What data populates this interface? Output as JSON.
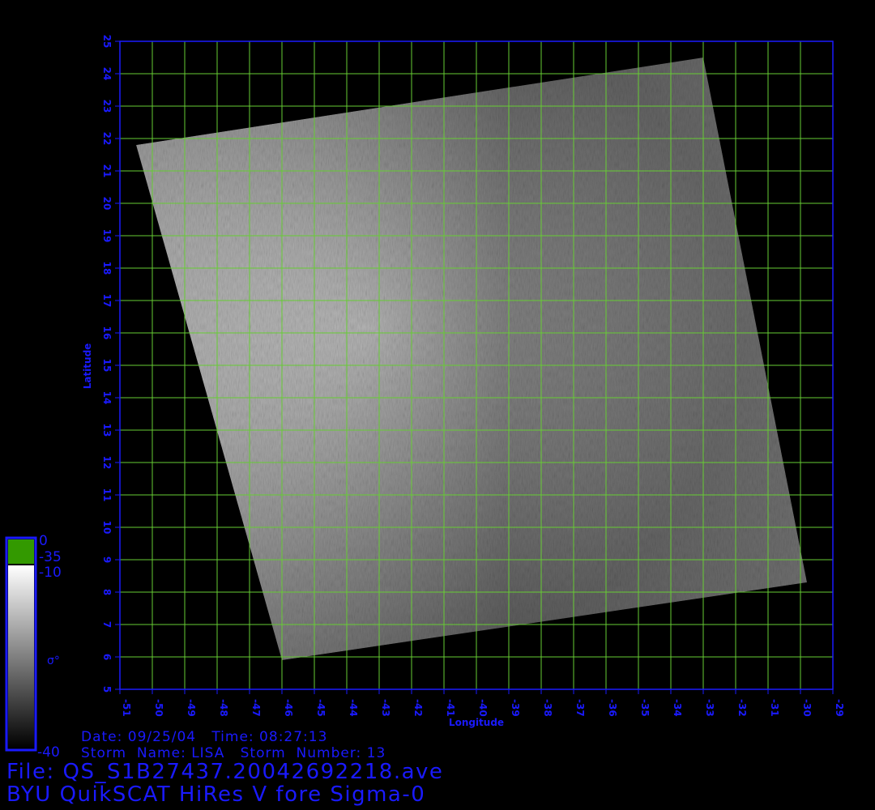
{
  "map": {
    "lon_min": -51,
    "lon_max": -29,
    "lat_min": 5,
    "lat_max": 25,
    "x_ticks": [
      "-51",
      "-50",
      "-49",
      "-48",
      "-47",
      "-46",
      "-45",
      "-44",
      "-43",
      "-42",
      "-41",
      "-40",
      "-39",
      "-38",
      "-37",
      "-36",
      "-35",
      "-34",
      "-33",
      "-32",
      "-31",
      "-30",
      "-29"
    ],
    "y_ticks": [
      "5",
      "6",
      "7",
      "8",
      "9",
      "10",
      "11",
      "12",
      "13",
      "14",
      "15",
      "16",
      "17",
      "18",
      "19",
      "20",
      "21",
      "22",
      "23",
      "24",
      "25"
    ],
    "xlabel": "Longitude",
    "ylabel": "Latitude",
    "grid": true,
    "grid_color": "#66cc33",
    "axis_color": "#1a1aff",
    "swath_corners_lonlat": [
      [
        -50.5,
        21.8
      ],
      [
        -33.0,
        24.5
      ],
      [
        -29.8,
        8.3
      ],
      [
        -46.0,
        5.9
      ]
    ]
  },
  "colorbar": {
    "top_label": "0",
    "green_bottom_label": "-35",
    "white_label": "-10",
    "bottom_label": "-40",
    "symbol": "σ°",
    "green_color": "#339900",
    "white_color": "#ffffff",
    "dark_color": "#000000"
  },
  "info": {
    "date_line": "Date: 09/25/04   Time: 08:27:13",
    "storm_line": "Storm  Name: LISA   Storm  Number: 13",
    "file_line": "File: QS_S1B27437.20042692218.ave",
    "product_line": "BYU QuikSCAT HiRes V fore Sigma-0"
  }
}
